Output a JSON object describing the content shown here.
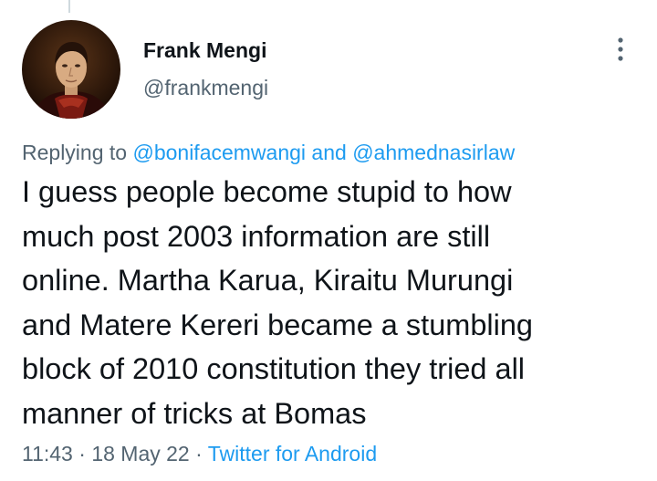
{
  "tweet": {
    "author": {
      "display_name": "Frank Mengi",
      "handle": "@frankmengi",
      "avatar": "portrait-avatar"
    },
    "more_icon": "vertical-ellipsis-icon",
    "reply_context": {
      "prefix": "Replying to ",
      "mention_1": "@bonifacemwangi",
      "connector": " and ",
      "mention_2": "@ahmednasirlaw"
    },
    "text_lines": [
      "I guess people become stupid to how",
      "much post 2003 information are still",
      "online. Martha Karua, Kiraitu Murungi",
      "and Matere Kereri became a stumbling",
      "block of 2010 constitution they tried all",
      "manner of tricks at Bomas"
    ],
    "time": "11:43",
    "date": "18 May 22",
    "separator": " · ",
    "source": "Twitter for Android"
  },
  "colors": {
    "text": "#0f1419",
    "secondary": "#536471",
    "link": "#1d9bf0",
    "thread_line": "#cfd9de"
  }
}
